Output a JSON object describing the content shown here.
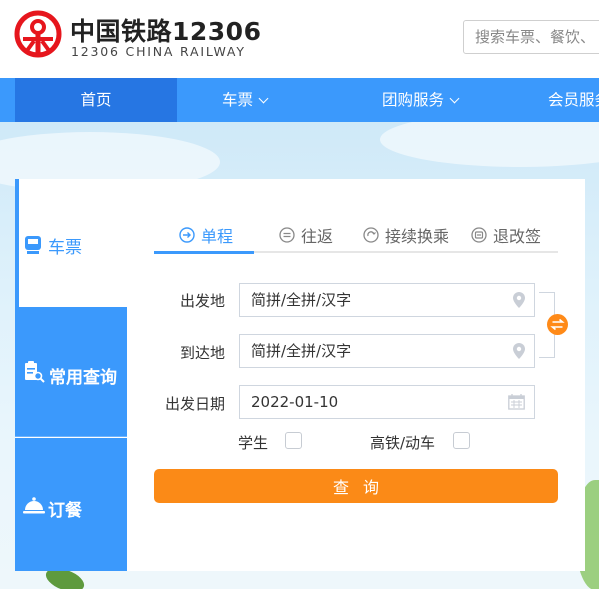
{
  "brand": {
    "title": "中国铁路12306",
    "subtitle": "12306 CHINA RAILWAY",
    "color": "#e6161d"
  },
  "search": {
    "placeholder": "搜索车票、餐饮、"
  },
  "nav": {
    "items": [
      {
        "label": "首页",
        "active": true
      },
      {
        "label": "车票",
        "dropdown": true
      },
      {
        "label": "团购服务",
        "dropdown": true
      },
      {
        "label": "会员服务"
      }
    ],
    "color": "#3b99fc",
    "active_color": "#2676e3"
  },
  "sidebar": {
    "items": [
      {
        "label": "车票",
        "icon": "train-icon",
        "active": true
      },
      {
        "label": "常用查询",
        "icon": "document-search-icon"
      },
      {
        "label": "订餐",
        "icon": "food-cloche-icon"
      }
    ]
  },
  "trip_tabs": [
    {
      "label": "单程",
      "icon": "arrow-right-circle-icon",
      "active": true
    },
    {
      "label": "往返",
      "icon": "round-trip-icon"
    },
    {
      "label": "接续换乘",
      "icon": "transfer-icon"
    },
    {
      "label": "退改签",
      "icon": "refund-icon"
    }
  ],
  "form": {
    "from": {
      "label": "出发地",
      "placeholder": "简拼/全拼/汉字"
    },
    "to": {
      "label": "到达地",
      "placeholder": "简拼/全拼/汉字"
    },
    "date": {
      "label": "出发日期",
      "value": "2022-01-10"
    },
    "student": {
      "label": "学生",
      "checked": false
    },
    "highspeed": {
      "label": "高铁/动车",
      "checked": false
    },
    "query_label": "查询",
    "query_color": "#fb8a17"
  }
}
